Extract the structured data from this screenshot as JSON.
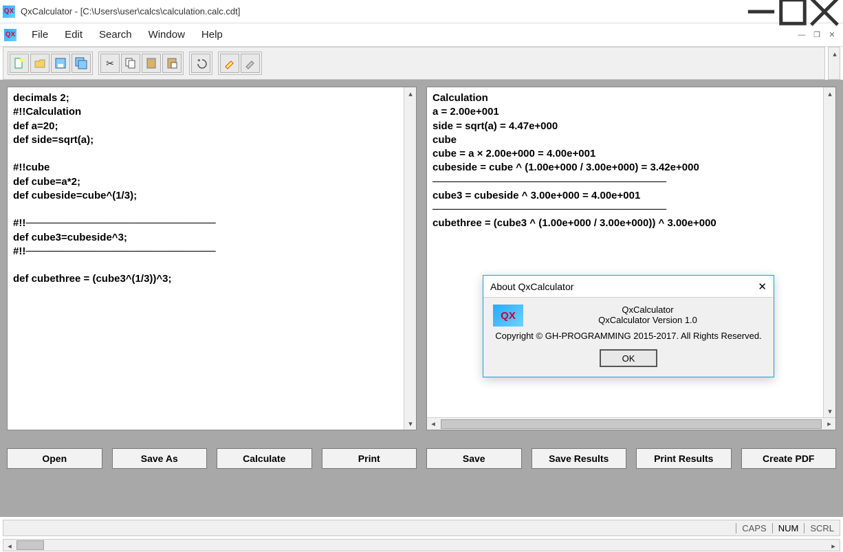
{
  "window": {
    "title": "QxCalculator - [C:\\Users\\user\\calcs\\calculation.calc.cdt]"
  },
  "menu": {
    "items": [
      "File",
      "Edit",
      "Search",
      "Window",
      "Help"
    ]
  },
  "toolbar": {
    "groups": [
      [
        "new-doc-icon",
        "open-doc-icon",
        "save-icon",
        "save-all-icon"
      ],
      [
        "cut-icon",
        "copy-icon",
        "paste-icon",
        "paste-special-icon"
      ],
      [
        "undo-icon"
      ],
      [
        "highlighter-icon",
        "clear-highlight-icon"
      ]
    ]
  },
  "editor": {
    "lines": [
      "decimals 2;",
      "#!!Calculation",
      "def a=20;",
      "def side=sqrt(a);",
      "",
      "#!!cube",
      "def cube=a*2;",
      "def cubeside=cube^(1/3);",
      "",
      "#!!──────────────────────────",
      "def cube3=cubeside^3;",
      "#!!──────────────────────────",
      "",
      "def cubethree = (cube3^(1/3))^3;"
    ]
  },
  "output": {
    "lines": [
      "Calculation",
      "a = 2.00e+001",
      "side = sqrt(a) = 4.47e+000",
      "cube",
      "cube = a × 2.00e+000 = 4.00e+001",
      "cubeside = cube ^ (1.00e+000 / 3.00e+000) = 3.42e+000",
      "────────────────────────────────",
      "cube3 = cubeside ^ 3.00e+000 = 4.00e+001",
      "────────────────────────────────",
      "cubethree = (cube3 ^ (1.00e+000 / 3.00e+000)) ^ 3.00e+000"
    ]
  },
  "buttons": {
    "open": "Open",
    "saveas": "Save As",
    "calculate": "Calculate",
    "print": "Print",
    "save": "Save",
    "saveresults": "Save Results",
    "printresults": "Print Results",
    "createpdf": "Create PDF"
  },
  "status": {
    "caps": "CAPS",
    "num": "NUM",
    "scrl": "SCRL"
  },
  "dialog": {
    "title": "About QxCalculator",
    "line1": "QxCalculator",
    "line2": "QxCalculator Version 1.0",
    "line3": "Copyright © GH-PROGRAMMING 2015-2017. All Rights Reserved.",
    "ok": "OK",
    "logo": "QX"
  }
}
